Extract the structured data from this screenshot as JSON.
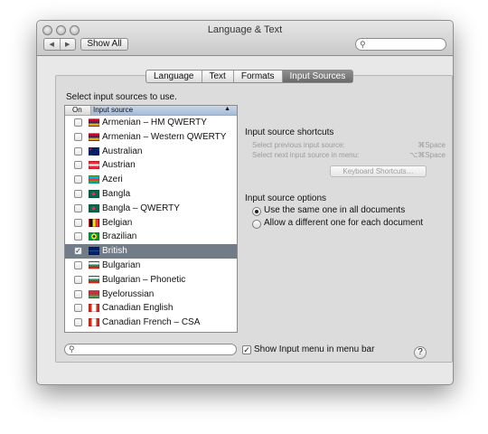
{
  "window": {
    "title": "Language & Text",
    "back_glyph": "◀",
    "forward_glyph": "▶",
    "show_all_label": "Show All",
    "search_icon": "search-icon",
    "search_glyph": "⚲",
    "search_placeholder": ""
  },
  "tabs": [
    {
      "label": "Language",
      "active": false
    },
    {
      "label": "Text",
      "active": false
    },
    {
      "label": "Formats",
      "active": false
    },
    {
      "label": "Input Sources",
      "active": true
    }
  ],
  "list": {
    "instruction": "Select input sources to use.",
    "col_on": "On",
    "col_source": "Input source",
    "sort_glyph": "▲",
    "check_glyph": "✓",
    "items": [
      {
        "label": "Armenian – HM QWERTY",
        "checked": false,
        "selected": false,
        "flag": "armenia"
      },
      {
        "label": "Armenian – Western QWERTY",
        "checked": false,
        "selected": false,
        "flag": "armenia"
      },
      {
        "label": "Australian",
        "checked": false,
        "selected": false,
        "flag": "australia"
      },
      {
        "label": "Austrian",
        "checked": false,
        "selected": false,
        "flag": "austria"
      },
      {
        "label": "Azeri",
        "checked": false,
        "selected": false,
        "flag": "azerbaijan"
      },
      {
        "label": "Bangla",
        "checked": false,
        "selected": false,
        "flag": "bangla"
      },
      {
        "label": "Bangla – QWERTY",
        "checked": false,
        "selected": false,
        "flag": "bangla"
      },
      {
        "label": "Belgian",
        "checked": false,
        "selected": false,
        "flag": "belgium"
      },
      {
        "label": "Brazilian",
        "checked": false,
        "selected": false,
        "flag": "brazil"
      },
      {
        "label": "British",
        "checked": true,
        "selected": true,
        "flag": "uk"
      },
      {
        "label": "Bulgarian",
        "checked": false,
        "selected": false,
        "flag": "bulgaria"
      },
      {
        "label": "Bulgarian – Phonetic",
        "checked": false,
        "selected": false,
        "flag": "bulgaria"
      },
      {
        "label": "Byelorussian",
        "checked": false,
        "selected": false,
        "flag": "belarus"
      },
      {
        "label": "Canadian English",
        "checked": false,
        "selected": false,
        "flag": "canada"
      },
      {
        "label": "Canadian French – CSA",
        "checked": false,
        "selected": false,
        "flag": "canada-csa"
      }
    ]
  },
  "shortcuts": {
    "title": "Input source shortcuts",
    "prev_label": "Select previous input source:",
    "prev_key": "⌘Space",
    "next_label": "Select next input source in menu:",
    "next_key": "⌥⌘Space",
    "keyboard_button": "Keyboard Shortcuts…"
  },
  "options": {
    "title": "Input source options",
    "same_label": "Use the same one in all documents",
    "same_selected": true,
    "different_label": "Allow a different one for each document",
    "different_selected": false
  },
  "bottom": {
    "search_glyph": "⚲",
    "show_menu_label": "Show Input menu in menu bar",
    "show_menu_checked": true,
    "show_menu_glyph": "✓",
    "help_label": "?"
  },
  "colors": {
    "selected_row": "#727b88",
    "window_bg": "#e8e8e8",
    "pane_bg": "#dcdcdc",
    "disabled_text": "#9b9b9b"
  }
}
